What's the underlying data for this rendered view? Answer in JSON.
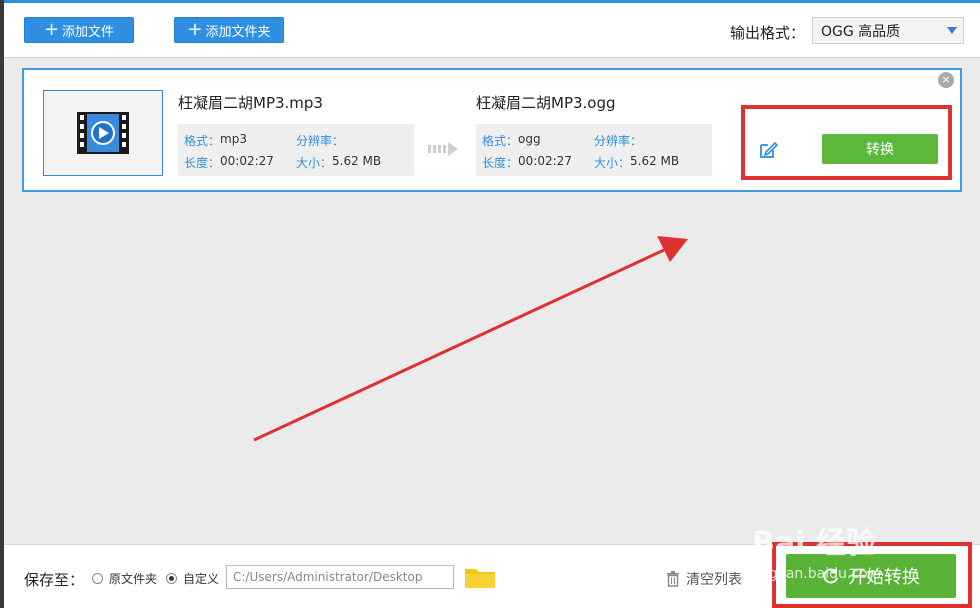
{
  "toolbar": {
    "add_file_label": "添加文件",
    "add_folder_label": "添加文件夹",
    "output_format_label": "输出格式：",
    "output_format_value": "OGG  高品质"
  },
  "file": {
    "source": {
      "name": "枉凝眉二胡MP3.mp3",
      "format_key": "格式：",
      "format_value": "mp3",
      "resolution_key": "分辨率：",
      "resolution_value": "",
      "duration_key": "长度：",
      "duration_value": "00:02:27",
      "size_key": "大小：",
      "size_value": "5.62 MB"
    },
    "target": {
      "name": "枉凝眉二胡MP3.ogg",
      "format_key": "格式：",
      "format_value": "ogg",
      "resolution_key": "分辨率：",
      "resolution_value": "",
      "duration_key": "长度：",
      "duration_value": "00:02:27",
      "size_key": "大小：",
      "size_value": "5.62 MB"
    },
    "convert_label": "转换",
    "close_symbol": "×"
  },
  "bottom": {
    "save_to_label": "保存至：",
    "radio_original_label": "原文件夹",
    "radio_custom_label": "自定义",
    "path_value": "C:/Users/Administrator/Desktop",
    "clear_list_label": "清空列表",
    "start_convert_label": "开始转换"
  },
  "watermark": {
    "text": "Bai 经验",
    "url": "jingyan.baidu.com"
  },
  "colors": {
    "accent_blue": "#2f90e3",
    "convert_green": "#5cb83c",
    "annotation_red": "#e03131"
  },
  "icons": {
    "video_thumbnail": "film-play-icon",
    "edit": "edit-icon",
    "folder": "folder-icon",
    "trash": "trash-icon",
    "start": "refresh-icon"
  }
}
